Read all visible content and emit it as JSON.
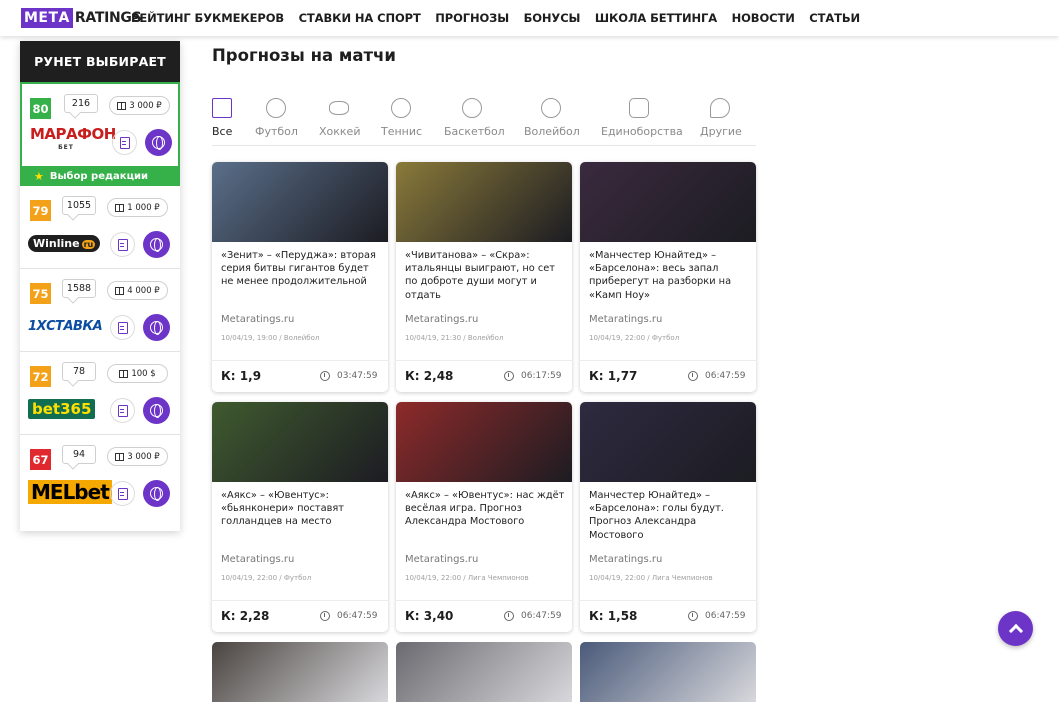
{
  "header": {
    "logo_meta": "МЕТА",
    "logo_ratings": "RATINGS",
    "nav": [
      {
        "label": "РЕЙТИНГ БУКМЕКЕРОВ"
      },
      {
        "label": "СТАВКИ НА СПОРТ"
      },
      {
        "label": "ПРОГНОЗЫ"
      },
      {
        "label": "БОНУСЫ"
      },
      {
        "label": "ШКОЛА БЕТТИНГА"
      },
      {
        "label": "НОВОСТИ"
      },
      {
        "label": "СТАТЬИ"
      }
    ]
  },
  "sidebar": {
    "title": "РУНЕТ ВЫБИРАЕТ",
    "editor_choice": "Выбор редакции",
    "bookmakers": [
      {
        "score": "80",
        "score_color": "#36b14a",
        "count": "216",
        "bonus": "3 000 ₽",
        "logo_text": "МАРАФОН",
        "logo_sub": "БЕТ"
      },
      {
        "score": "79",
        "score_color": "#f4a11a",
        "count": "1055",
        "bonus": "1 000 ₽",
        "logo_text": "Winline",
        "logo_sub": "ru"
      },
      {
        "score": "75",
        "score_color": "#f4a11a",
        "count": "1588",
        "bonus": "4 000 ₽",
        "logo_text": "1XСТАВКА"
      },
      {
        "score": "72",
        "score_color": "#f4a11a",
        "count": "78",
        "bonus": "100 $",
        "logo_text": "bet365"
      },
      {
        "score": "67",
        "score_color": "#e0282e",
        "count": "94",
        "bonus": "3 000 ₽",
        "logo_text": "MELbet"
      }
    ]
  },
  "main": {
    "title": "Прогнозы на матчи",
    "categories": [
      {
        "label": "Все",
        "icon": "all-icon"
      },
      {
        "label": "Футбол",
        "icon": "football-icon"
      },
      {
        "label": "Хоккей",
        "icon": "hockey-icon"
      },
      {
        "label": "Теннис",
        "icon": "tennis-icon"
      },
      {
        "label": "Баскетбол",
        "icon": "basketball-icon"
      },
      {
        "label": "Волейбол",
        "icon": "volleyball-icon"
      },
      {
        "label": "Единоборства",
        "icon": "combat-icon"
      },
      {
        "label": "Другие",
        "icon": "whistle-icon"
      }
    ],
    "cards": [
      {
        "title": "«Зенит» – «Перуджа»: вторая серия битвы гигантов будет не менее продолжительной",
        "source": "Metaratings.ru",
        "meta": "10/04/19, 19:00 / Волейбол",
        "coef": "К: 1,9",
        "time": "03:47:59",
        "img_color": "#5a6f8a"
      },
      {
        "title": "«Чивитанова» – «Скра»: итальянцы выиграют, но сет по доброте души могут и отдать",
        "source": "Metaratings.ru",
        "meta": "10/04/19, 21:30 / Волейбол",
        "coef": "К: 2,48",
        "time": "06:17:59",
        "img_color": "#8a7a3a"
      },
      {
        "title": "«Манчестер Юнайтед» – «Барселона»: весь запал приберегут на разборки на «Камп Ноу»",
        "source": "Metaratings.ru",
        "meta": "10/04/19, 22:00 / Футбол",
        "coef": "К: 1,77",
        "time": "06:47:59",
        "img_color": "#3a2a3e"
      },
      {
        "title": "«Аякс» – «Ювентус»: «бьянконери» поставят голландцев на место",
        "source": "Metaratings.ru",
        "meta": "10/04/19, 22:00 / Футбол",
        "coef": "К: 2,28",
        "time": "06:47:59",
        "img_color": "#3f5a2f"
      },
      {
        "title": "«Аякс» – «Ювентус»: нас ждёт весёлая игра. Прогноз Александра Мостового",
        "source": "Metaratings.ru",
        "meta": "10/04/19, 22:00 / Лига Чемпионов",
        "coef": "К: 3,40",
        "time": "06:47:59",
        "img_color": "#8e2a2a"
      },
      {
        "title": "Манчестер Юнайтед» – «Барселона»: голы будут. Прогноз Александра Мостового",
        "source": "Metaratings.ru",
        "meta": "10/04/19, 22:00 / Лига Чемпионов",
        "coef": "К: 1,58",
        "time": "06:47:59",
        "img_color": "#2e2a40"
      }
    ],
    "partial_colors": [
      "#4a4440",
      "#6a6a70",
      "#4a5a7a"
    ]
  }
}
